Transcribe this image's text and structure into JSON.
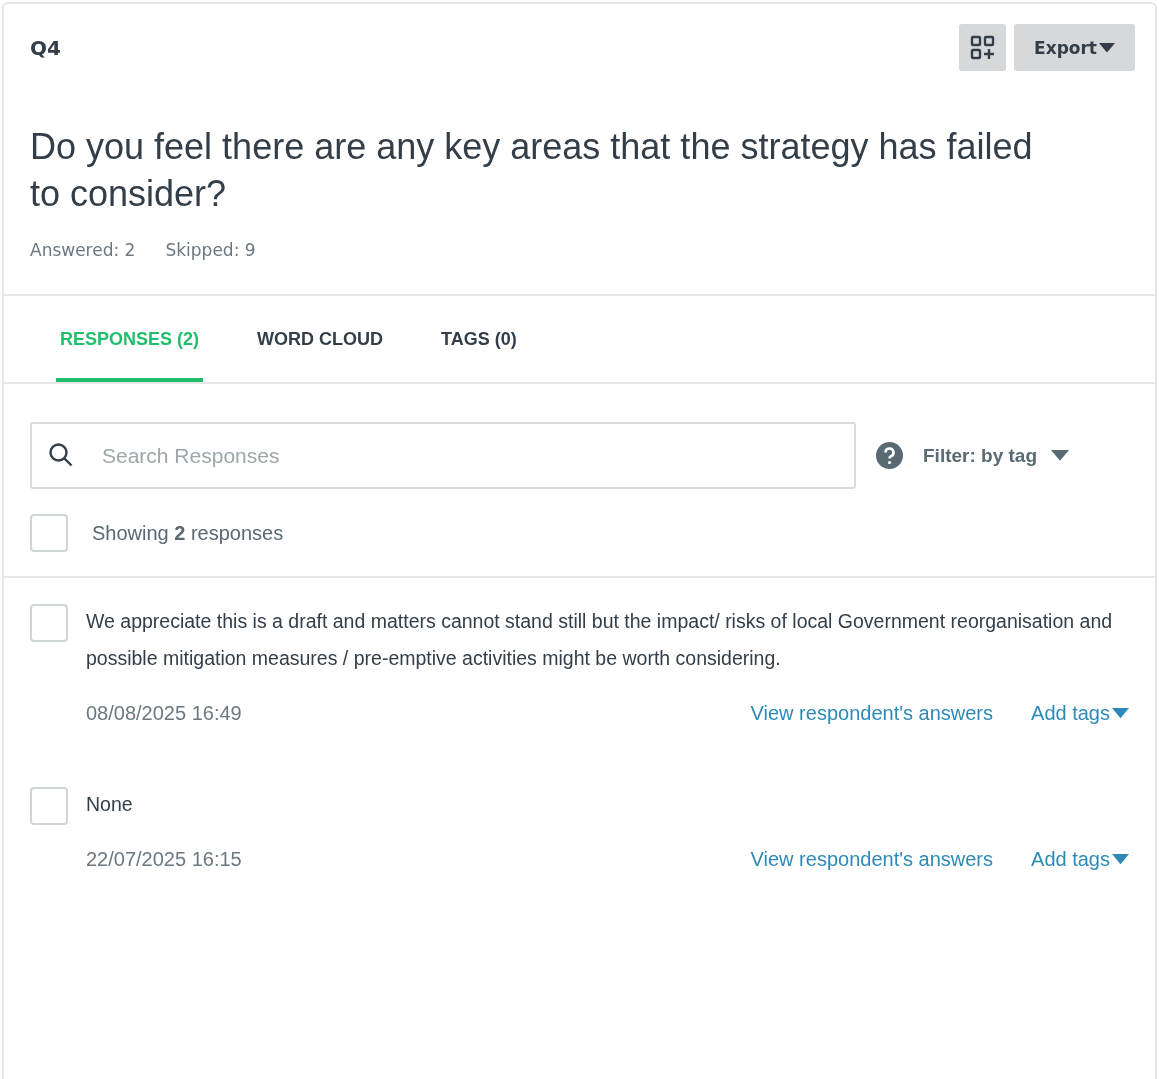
{
  "question": {
    "number": "Q4",
    "title": "Do you feel there are any key areas that the strategy has failed to consider?",
    "stats": [
      "Answered: 2",
      "Skipped: 9"
    ]
  },
  "toolbar": {
    "export_label": "Export"
  },
  "tabs": [
    {
      "label": "RESPONSES (2)",
      "selected": true
    },
    {
      "label": "WORD CLOUD",
      "selected": false
    },
    {
      "label": "TAGS (0)",
      "selected": false
    }
  ],
  "search": {
    "placeholder": "Search Responses"
  },
  "filter": {
    "label": "Filter: by tag"
  },
  "select_all": {
    "checked": false,
    "label": "Showing **2** responses"
  },
  "responses": [
    {
      "checked": false,
      "text": "We appreciate this is a draft and matters cannot stand still but the impact/ risks of local Government reorganisation and possible mitigation measures / pre-emptive activities might be worth considering.",
      "date": "08/08/2025 16:49",
      "view_link": "View respondent's answers",
      "tags_link": "Add tags"
    },
    {
      "checked": false,
      "text": "None",
      "date": "22/07/2025 16:15",
      "view_link": "View respondent's answers",
      "tags_link": "Add tags"
    }
  ]
}
